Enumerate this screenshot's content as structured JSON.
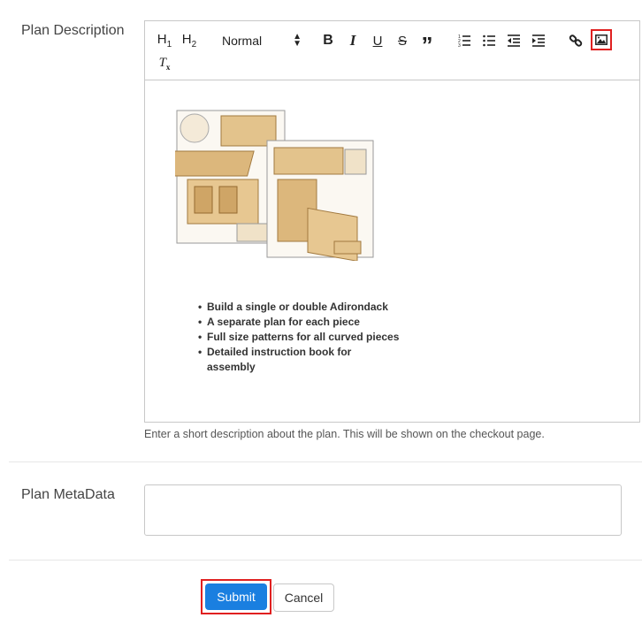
{
  "fields": {
    "plan_description_label": "Plan Description",
    "plan_metadata_label": "Plan MetaData",
    "description_hint": "Enter a short description about the plan. This will be shown on the checkout page.",
    "metadata_value": ""
  },
  "toolbar": {
    "h1": "H",
    "h1_sub": "1",
    "h2": "H",
    "h2_sub": "2",
    "format_select": "Normal",
    "bold": "B",
    "italic": "I",
    "underline": "U",
    "strike": "S",
    "quote": "”",
    "clean": "T",
    "clean_sub": "x",
    "icons": [
      "header-1-icon",
      "header-2-icon",
      "bold-icon",
      "italic-icon",
      "underline-icon",
      "strike-icon",
      "blockquote-icon",
      "ordered-list-icon",
      "bullet-list-icon",
      "outdent-icon",
      "indent-icon",
      "link-icon",
      "image-icon",
      "clear-format-icon"
    ]
  },
  "content": {
    "bullets": [
      "Build a single or double Adirondack",
      "A separate plan for each piece",
      "Full size patterns for all curved pieces",
      "Detailed instruction book for assembly"
    ]
  },
  "actions": {
    "submit": "Submit",
    "cancel": "Cancel"
  },
  "colors": {
    "primary": "#1a7fe0",
    "highlight": "#e02020",
    "border": "#c8c8c8"
  }
}
